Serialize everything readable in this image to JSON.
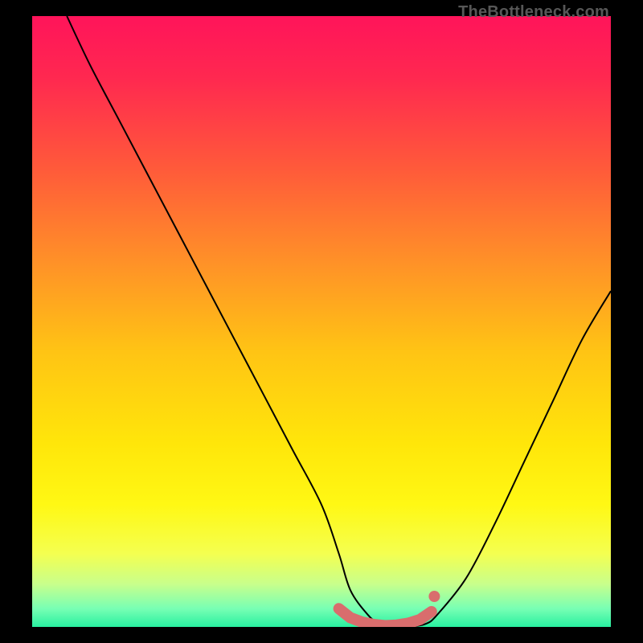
{
  "watermark": "TheBottleneck.com",
  "colors": {
    "black": "#000000",
    "curve": "#000000",
    "marker": "#d96d6d",
    "gradient_stops": [
      {
        "offset": 0.0,
        "color": "#ff145a"
      },
      {
        "offset": 0.1,
        "color": "#ff2850"
      },
      {
        "offset": 0.25,
        "color": "#ff5a3a"
      },
      {
        "offset": 0.4,
        "color": "#ff9028"
      },
      {
        "offset": 0.55,
        "color": "#ffc414"
      },
      {
        "offset": 0.7,
        "color": "#ffe60a"
      },
      {
        "offset": 0.8,
        "color": "#fff814"
      },
      {
        "offset": 0.88,
        "color": "#f4ff50"
      },
      {
        "offset": 0.93,
        "color": "#c8ff8c"
      },
      {
        "offset": 0.97,
        "color": "#78ffb4"
      },
      {
        "offset": 1.0,
        "color": "#28f0a0"
      }
    ]
  },
  "chart_data": {
    "type": "line",
    "title": "",
    "xlabel": "",
    "ylabel": "",
    "xlim": [
      0,
      100
    ],
    "ylim": [
      0,
      100
    ],
    "grid": false,
    "legend": false,
    "series": [
      {
        "name": "bottleneck-curve",
        "x": [
          6,
          10,
          15,
          20,
          25,
          30,
          35,
          40,
          45,
          50,
          53,
          55,
          58,
          60,
          62,
          65,
          68,
          70,
          75,
          80,
          85,
          90,
          95,
          100
        ],
        "y": [
          100,
          92,
          83,
          74,
          65,
          56,
          47,
          38,
          29,
          20,
          12,
          6,
          2,
          0.5,
          0,
          0,
          0.5,
          2,
          8,
          17,
          27,
          37,
          47,
          55
        ]
      }
    ],
    "highlight_region": {
      "name": "flat-minimum-marker",
      "x": [
        53,
        55,
        57,
        59,
        61,
        63,
        65,
        67,
        69
      ],
      "y": [
        3.0,
        1.5,
        0.8,
        0.4,
        0.2,
        0.3,
        0.6,
        1.2,
        2.5
      ]
    }
  }
}
